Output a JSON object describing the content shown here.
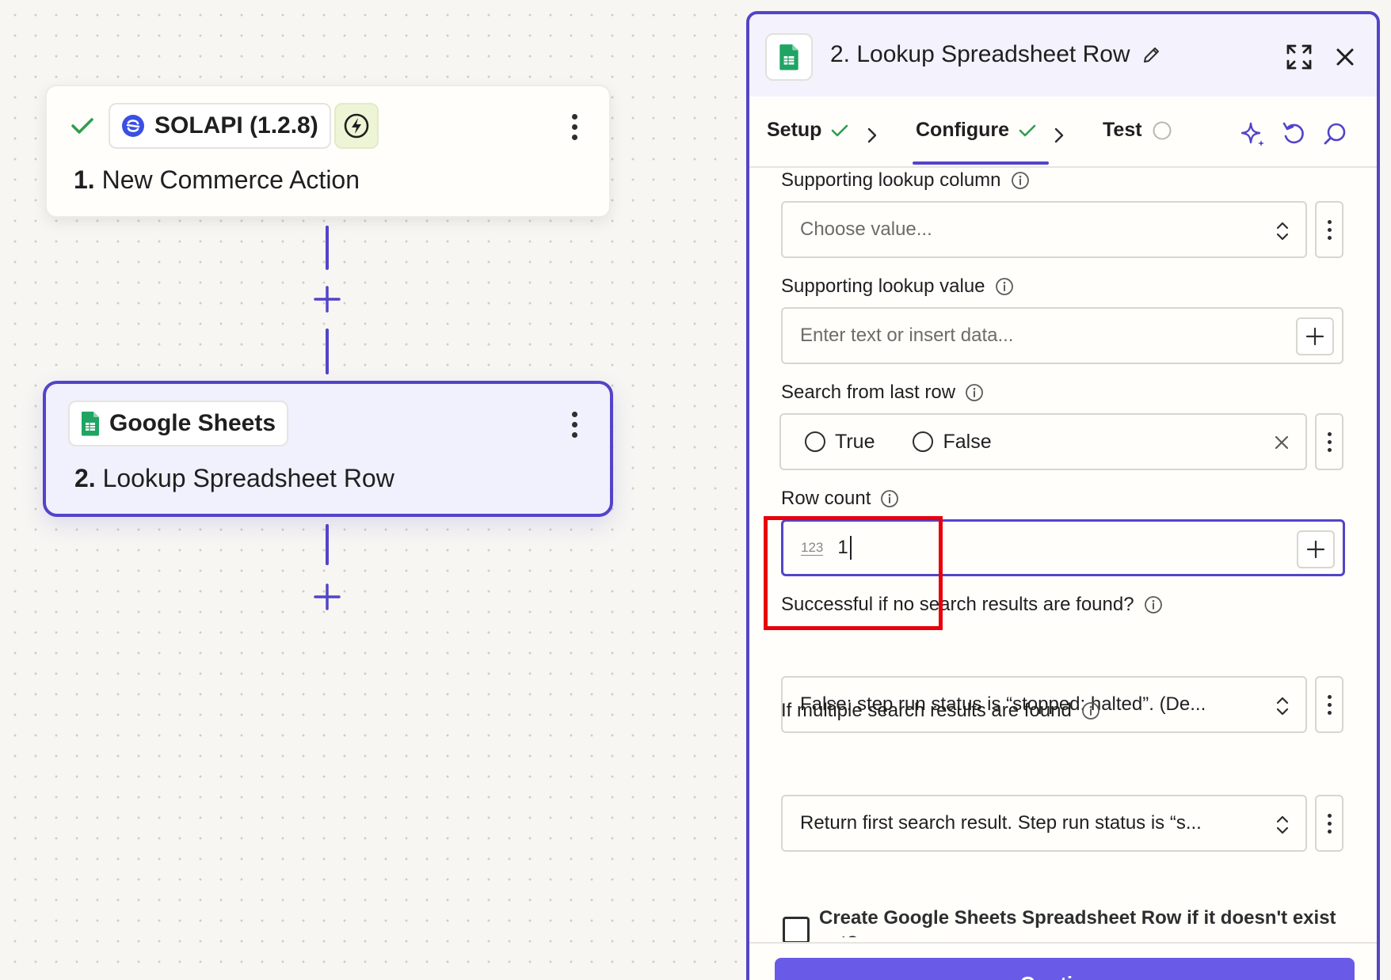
{
  "canvas": {
    "step1": {
      "app_chip": "SOLAPI (1.2.8)",
      "number": "1.",
      "title": "New Commerce Action",
      "status": "check"
    },
    "step2": {
      "app_chip": "Google Sheets",
      "number": "2.",
      "title": "Lookup Spreadsheet Row"
    }
  },
  "panel": {
    "title": "2. Lookup Spreadsheet Row",
    "tabs": [
      {
        "label": "Setup",
        "state": "complete"
      },
      {
        "label": "Configure",
        "state": "complete"
      },
      {
        "label": "Test",
        "state": "pending"
      }
    ],
    "fields": {
      "supporting_lookup_column": {
        "label": "Supporting lookup column",
        "placeholder": "Choose value..."
      },
      "supporting_lookup_value": {
        "label": "Supporting lookup value",
        "placeholder": "Enter text or insert data..."
      },
      "search_from_last_row": {
        "label": "Search from last row",
        "options": [
          "True",
          "False"
        ]
      },
      "row_count": {
        "label": "Row count",
        "type_tag": "123",
        "value": "1"
      },
      "successful_if_none": {
        "label": "Successful if no search results are found?",
        "value": "False: step run status is “stopped: halted”. (De..."
      },
      "multiple_results": {
        "label": "If multiple search results are found",
        "value": "Return first search result. Step run status is “s..."
      }
    },
    "create_if_missing_label": "Create Google Sheets Spreadsheet Row if it doesn't exist yet?",
    "continue_label": "Continue"
  },
  "colors": {
    "accent": "#5244c9",
    "button": "#695be8",
    "success": "#2e9e4f",
    "highlight": "#e8000b"
  }
}
